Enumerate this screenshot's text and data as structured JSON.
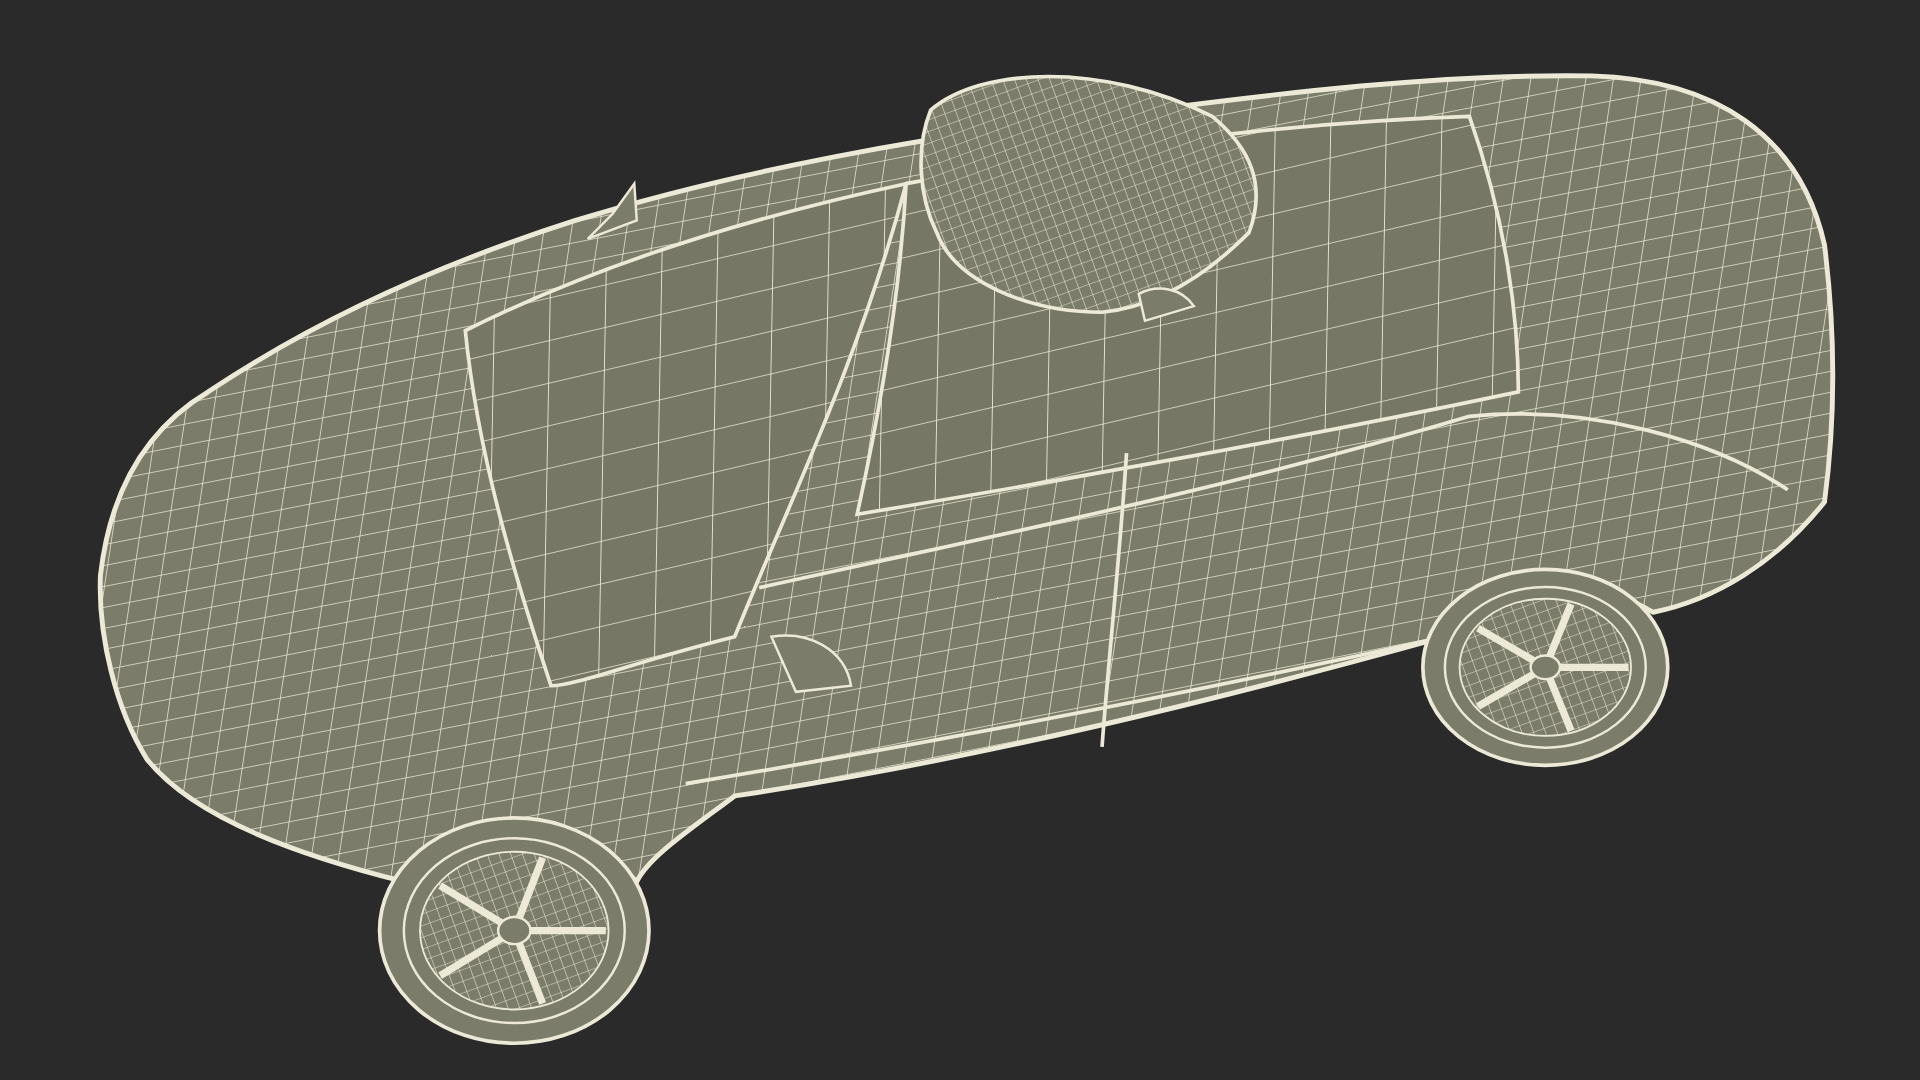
{
  "scene": {
    "kind": "car"
  }
}
